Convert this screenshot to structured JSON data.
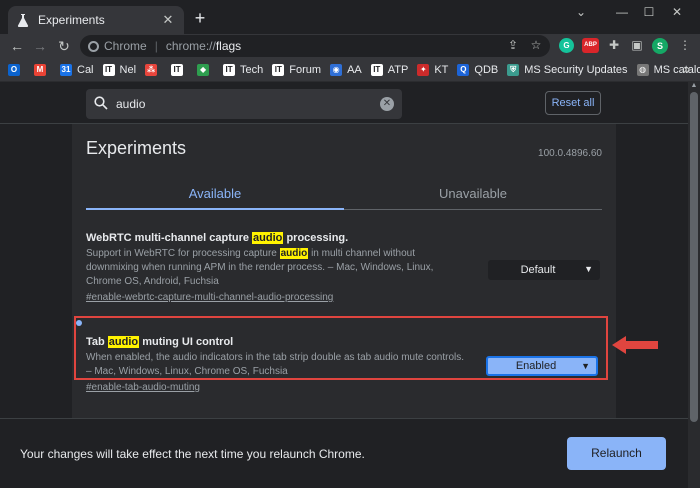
{
  "tab": {
    "title": "Experiments",
    "close": "✕",
    "new_tab": "+"
  },
  "window_controls": {
    "chevron": "⌄",
    "minimize": "—",
    "maximize": "☐",
    "close": "✕"
  },
  "toolbar": {
    "back": "←",
    "forward": "→",
    "reload": "↻",
    "chip_label": "Chrome",
    "url_scheme": "chrome://",
    "url_path": "flags",
    "extensions": [
      {
        "label": "G",
        "color": "#15c39a"
      },
      {
        "label": "ABP",
        "color": "#d9252a"
      }
    ],
    "profile_initial": "S",
    "profile_color": "#15a865",
    "menu": "⋮"
  },
  "bookmarks": [
    {
      "label": "",
      "icon_text": "O",
      "color": "#0b63ce"
    },
    {
      "label": "",
      "icon_text": "M",
      "color": "#ea4335"
    },
    {
      "label": "Cal",
      "icon_text": "31",
      "color": "#1a73e8"
    },
    {
      "label": "Nel",
      "icon_text": "IT",
      "color": "#ffffff",
      "dark": true
    },
    {
      "label": "",
      "icon_text": "⁂",
      "color": "#e8453c"
    },
    {
      "label": "",
      "icon_text": "IT",
      "color": "#ffffff",
      "dark": true
    },
    {
      "label": "",
      "icon_text": "◆",
      "color": "#2e9e4f"
    },
    {
      "label": "Tech",
      "icon_text": "IT",
      "color": "#ffffff",
      "dark": true
    },
    {
      "label": "Forum",
      "icon_text": "IT",
      "color": "#ffffff",
      "dark": true
    },
    {
      "label": "AA",
      "icon_text": "◉",
      "color": "#2f6fd6"
    },
    {
      "label": "ATP",
      "icon_text": "IT",
      "color": "#ffffff",
      "dark": true
    },
    {
      "label": "KT",
      "icon_text": "✦",
      "color": "#cc2b2b"
    },
    {
      "label": "QDB",
      "icon_text": "Q",
      "color": "#1c64d8"
    },
    {
      "label": "MS Security Updates",
      "icon_text": "⛨",
      "color": "#3b9b8e"
    },
    {
      "label": "MS catalog",
      "icon_text": "◍",
      "color": "#777777"
    }
  ],
  "bookmarks_more": "»",
  "search": {
    "value": "audio",
    "clear": "✕"
  },
  "reset_all": "Reset all",
  "page": {
    "heading": "Experiments",
    "version": "100.0.4896.60"
  },
  "tabs": {
    "available": "Available",
    "unavailable": "Unavailable"
  },
  "experiments": [
    {
      "name_before": "WebRTC multi-channel capture ",
      "name_highlight": "audio",
      "name_after": " processing.",
      "description_before": "Support in WebRTC for processing capture ",
      "description_highlight": "audio",
      "description_after": " in multi channel without downmixing when running APM in the render process. – Mac, Windows, Linux, Chrome OS, Android, Fuchsia",
      "link": "#enable-webrtc-capture-multi-channel-audio-processing",
      "value": "Default"
    },
    {
      "name_before": "Tab ",
      "name_highlight": "audio",
      "name_after": " muting UI control",
      "description": "When enabled, the audio indicators in the tab strip double as tab audio mute controls. – Mac, Windows, Linux, Chrome OS, Fuchsia",
      "link": "#enable-tab-audio-muting",
      "value": "Enabled"
    }
  ],
  "footer": {
    "message": "Your changes will take effect the next time you relaunch Chrome.",
    "relaunch": "Relaunch"
  },
  "colors": {
    "highlight": "#fff200",
    "accent": "#8ab4f8",
    "annotation": "#e0453f"
  }
}
